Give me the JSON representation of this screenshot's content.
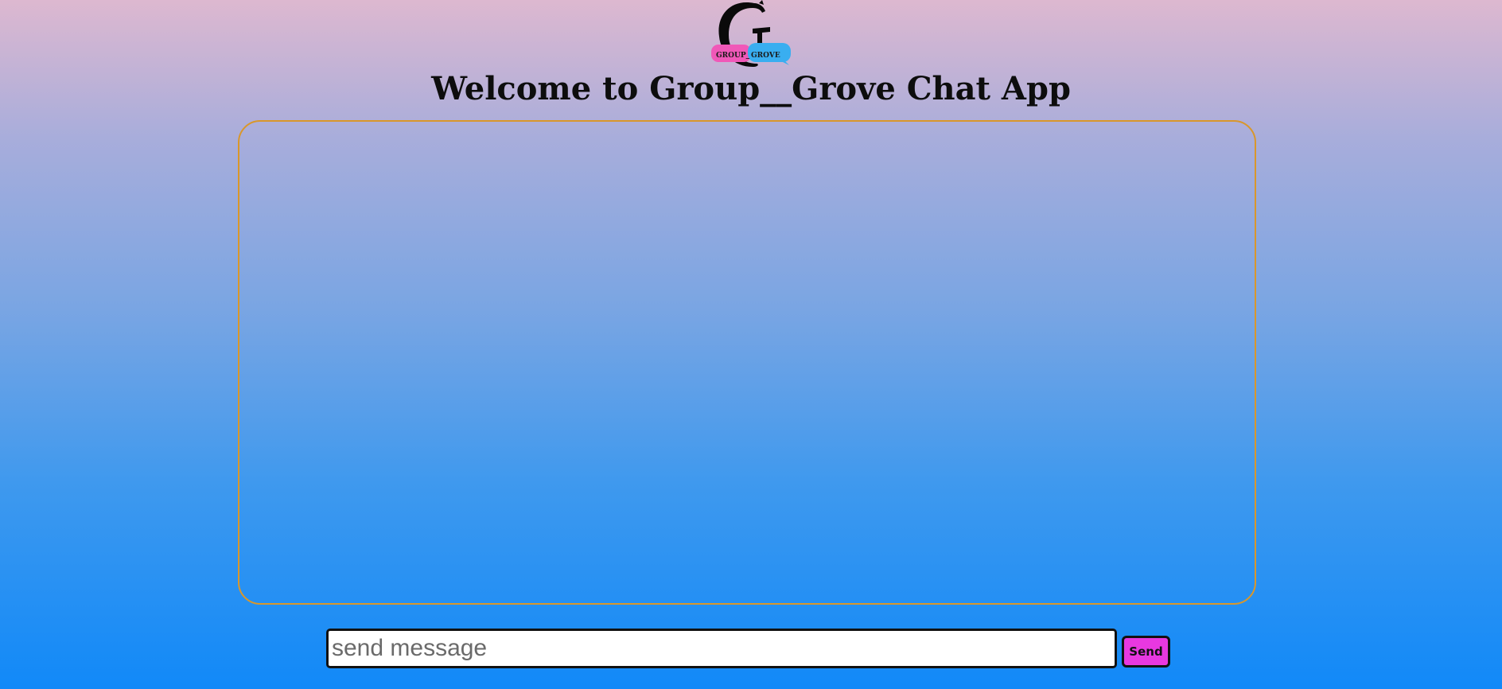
{
  "header": {
    "logo_icon": "group-grove-logo",
    "logo_left_text": "GROUP_",
    "logo_right_text": "GROVE",
    "title": "Welcome to Group__Grove Chat App"
  },
  "chat": {
    "messages": []
  },
  "composer": {
    "input_value": "",
    "input_placeholder": "send message",
    "send_label": "Send"
  },
  "colors": {
    "chat_border": "#d9972b",
    "send_button": "#e838e0",
    "logo_pink": "#f058b8",
    "logo_blue": "#39aef0"
  }
}
